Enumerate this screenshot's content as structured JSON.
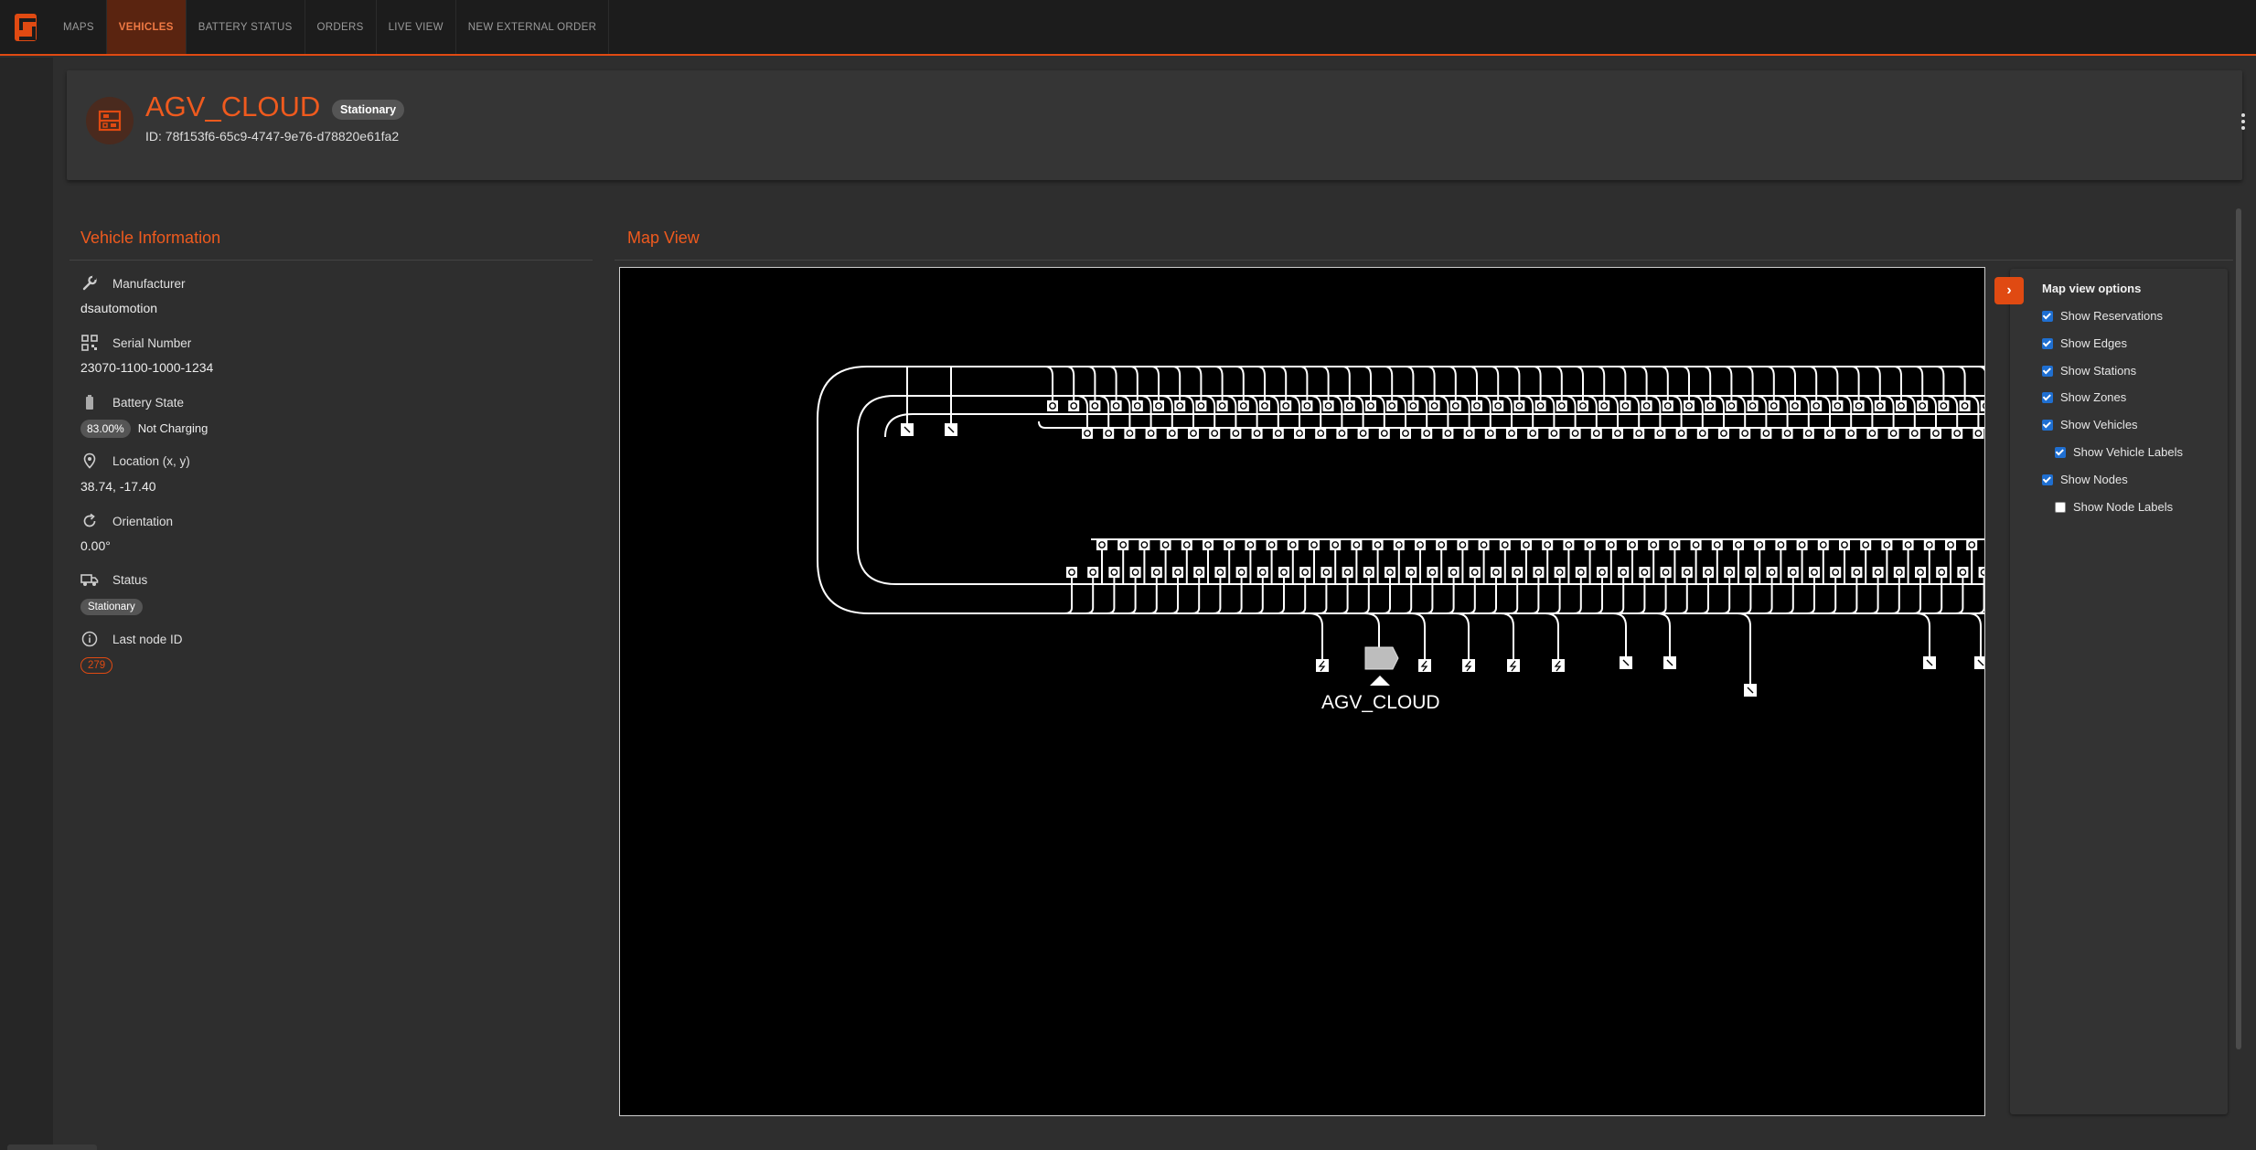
{
  "nav": {
    "tabs": [
      {
        "label": "MAPS"
      },
      {
        "label": "VEHICLES"
      },
      {
        "label": "BATTERY STATUS"
      },
      {
        "label": "ORDERS"
      },
      {
        "label": "LIVE VIEW"
      },
      {
        "label": "NEW EXTERNAL ORDER"
      }
    ],
    "active_tab": "VEHICLES"
  },
  "header": {
    "title": "AGV_CLOUD",
    "status": "Stationary",
    "id_text": "ID: 78f153f6-65c9-4747-9e76-d78820e61fa2"
  },
  "vehicle_info": {
    "title": "Vehicle Information",
    "manufacturer_label": "Manufacturer",
    "manufacturer_value": "dsautomotion",
    "serial_label": "Serial Number",
    "serial_value": "23070-1100-1000-1234",
    "battery_label": "Battery State",
    "battery_percent": "83.00%",
    "battery_charging": "Not Charging",
    "location_label": "Location (x, y)",
    "location_value": "38.74, -17.40",
    "orientation_label": "Orientation",
    "orientation_value": "0.00°",
    "status_label": "Status",
    "status_value": "Stationary",
    "last_node_label": "Last node ID",
    "last_node_value": "279"
  },
  "map_view": {
    "title": "Map View",
    "vehicle_label": "AGV_CLOUD"
  },
  "map_options": {
    "title": "Map view options",
    "show_reservations": {
      "label": "Show Reservations",
      "checked": true
    },
    "show_edges": {
      "label": "Show Edges",
      "checked": true
    },
    "show_stations": {
      "label": "Show Stations",
      "checked": true
    },
    "show_zones": {
      "label": "Show Zones",
      "checked": true
    },
    "show_vehicles": {
      "label": "Show Vehicles",
      "checked": true
    },
    "show_vehicle_labels": {
      "label": "Show Vehicle Labels",
      "checked": true
    },
    "show_nodes": {
      "label": "Show Nodes",
      "checked": true
    },
    "show_node_labels": {
      "label": "Show Node Labels",
      "checked": false
    }
  },
  "colors": {
    "accent": "#e04a12",
    "checkbox": "#1f6fd1",
    "background": "#2e2e2e"
  }
}
